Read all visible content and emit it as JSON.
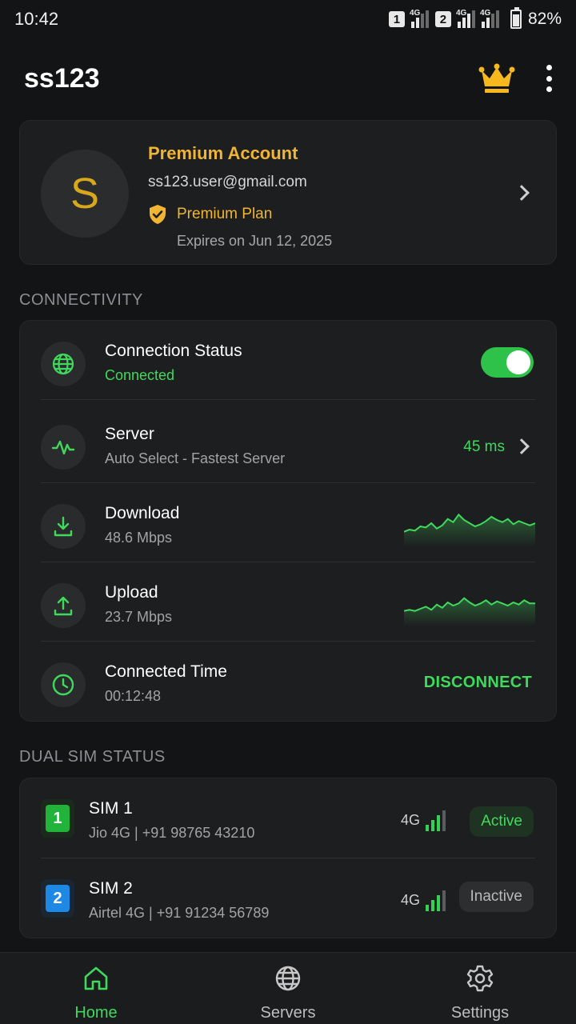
{
  "status_bar": {
    "time": "10:42",
    "sim1_slot": "1",
    "sim2_slot": "2",
    "net1": "4G",
    "net2": "4G",
    "net3": "4G",
    "battery": "82%",
    "battery_level": 0.82
  },
  "header": {
    "title": "ss123",
    "crown_icon": "crown-icon",
    "menu_icon": "more-vert-icon"
  },
  "account": {
    "avatar_initial": "S",
    "title": "Premium Account",
    "email": "ss123.user@gmail.com",
    "plan": "Premium Plan",
    "expires": "Expires on Jun 12, 2025"
  },
  "connectivity": {
    "heading": "CONNECTIVITY",
    "status": {
      "title": "Connection Status",
      "value": "Connected",
      "enabled": true
    },
    "server": {
      "title": "Server",
      "value": "Auto Select - Fastest Server",
      "latency": "45 ms"
    },
    "download": {
      "title": "Download",
      "value": "48.6 Mbps",
      "trend": [
        10,
        12,
        11,
        15,
        14,
        18,
        13,
        16,
        22,
        19,
        26,
        21,
        18,
        15,
        17,
        20,
        24,
        21,
        19,
        22,
        17,
        20,
        18,
        16,
        18
      ]
    },
    "upload": {
      "title": "Upload",
      "value": "23.7 Mbps",
      "trend": [
        10,
        11,
        10,
        12,
        14,
        11,
        16,
        13,
        18,
        15,
        17,
        22,
        18,
        15,
        17,
        20,
        16,
        19,
        17,
        15,
        18,
        16,
        20,
        17,
        17
      ]
    },
    "time": {
      "title": "Connected Time",
      "value": "00:12:48",
      "action": "DISCONNECT"
    }
  },
  "dual_sim": {
    "heading": "DUAL SIM STATUS",
    "sims": [
      {
        "badge": "1",
        "title": "SIM 1",
        "detail": "Jio 4G | +91 98765 43210",
        "network": "4G",
        "status": "Active",
        "badge_color": "#22b33a"
      },
      {
        "badge": "2",
        "title": "SIM 2",
        "detail": "Airtel 4G | +91 91234 56789",
        "network": "4G",
        "status": "Inactive",
        "badge_color": "#1e88e5"
      }
    ]
  },
  "nav": {
    "home": "Home",
    "servers": "Servers",
    "settings": "Settings"
  },
  "colors": {
    "accent": "#3fd95c",
    "gold": "#f0b532",
    "background": "#131415",
    "card": "#1d1e20"
  }
}
